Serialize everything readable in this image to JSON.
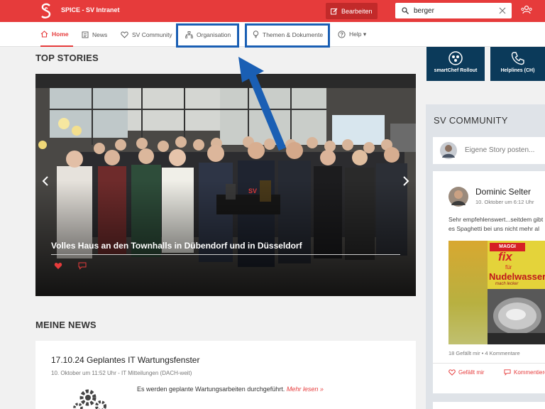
{
  "header": {
    "app_title": "SPICE - SV Intranet",
    "edit_label": "Bearbeiten",
    "search_value": "berger"
  },
  "nav": {
    "items": [
      {
        "label": "Home"
      },
      {
        "label": "News"
      },
      {
        "label": "SV Community"
      },
      {
        "label": "Organisation"
      },
      {
        "label": "Themen & Dokumente"
      },
      {
        "label": "Help ▾"
      }
    ]
  },
  "top_stories": {
    "title": "TOP STORIES",
    "caption": "Volles Haus an den Townhalls in Dübendorf und in Düsseldorf"
  },
  "meine_news": {
    "title": "MEINE NEWS",
    "item": {
      "title": "17.10.24 Geplantes IT Wartungsfenster",
      "meta": "10. Oktober um 11:52 Uhr - IT Mitteilungen (DACH-weit)",
      "text": "Es werden geplante Wartungsarbeiten durchgeführt.",
      "more": "Mehr lesen »"
    }
  },
  "tiles": [
    {
      "label": "smartChef Rollout",
      "icon": "chef-icon"
    },
    {
      "label": "Helplines (CH)",
      "icon": "phone-icon"
    }
  ],
  "community": {
    "title": "SV COMMUNITY",
    "post_placeholder": "Eigene Story posten...",
    "post": {
      "author": "Dominic Selter",
      "time": "10. Oktober um 6:12 Uhr",
      "text": "Sehr empfehlenswert...seitdem gibt es Spaghetti bei uns nicht mehr al dente",
      "image_text1": "MAGGI",
      "image_text2": "fix",
      "image_text3": "für",
      "image_text4": "Nudelwasser",
      "image_text5": "mach lecker",
      "likes": "18 Gefällt mir",
      "comments": "4 Kommentare",
      "like_label": "Gefällt mir",
      "comment_label": "Kommentieren"
    }
  },
  "colors": {
    "brand_red": "#e63b3b",
    "navy": "#0b3a5a",
    "highlight_blue": "#1a5fb4"
  }
}
